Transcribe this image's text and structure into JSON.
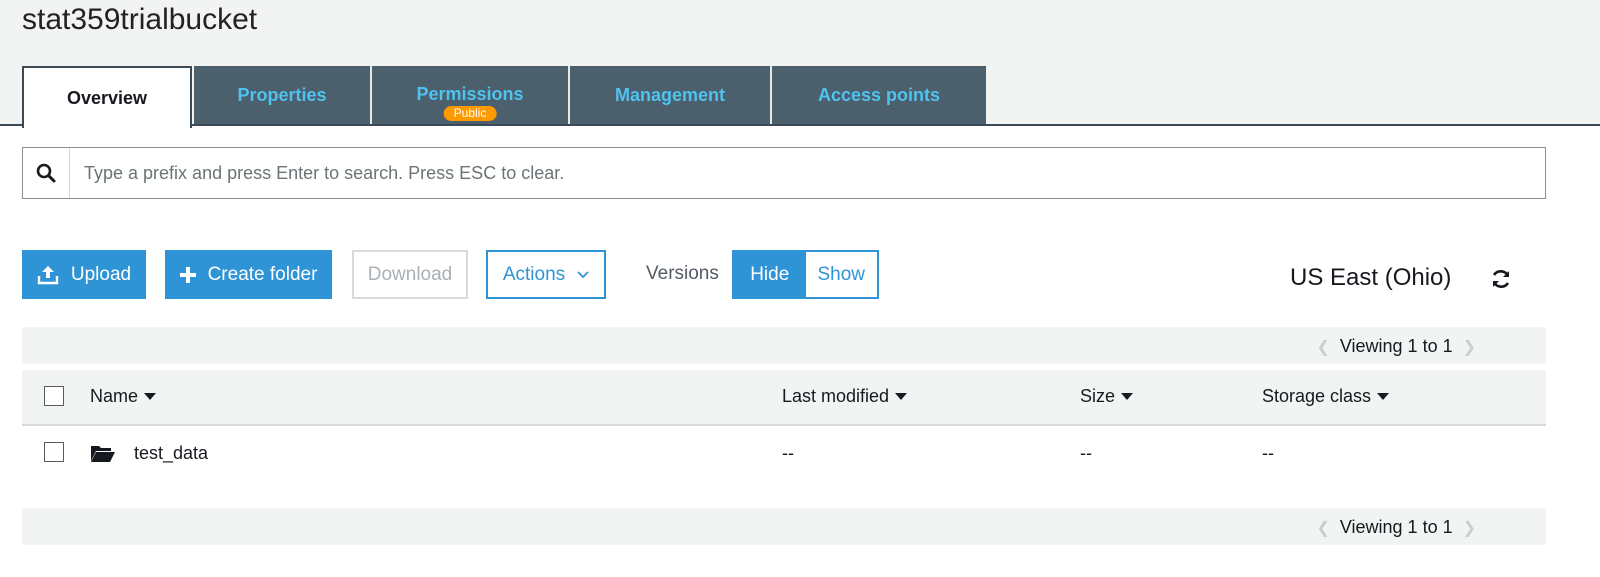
{
  "bucket": {
    "name": "stat359trialbucket"
  },
  "tabs": [
    {
      "label": "Overview"
    },
    {
      "label": "Properties"
    },
    {
      "label": "Permissions",
      "badge": "Public"
    },
    {
      "label": "Management"
    },
    {
      "label": "Access points"
    }
  ],
  "search": {
    "placeholder": "Type a prefix and press Enter to search. Press ESC to clear.",
    "value": "",
    "icon": "search-icon"
  },
  "toolbar": {
    "upload_label": "Upload",
    "create_folder_label": "Create folder",
    "download_label": "Download",
    "actions_label": "Actions",
    "versions_label": "Versions",
    "versions_hide": "Hide",
    "versions_show": "Show",
    "versions_selected": "Hide"
  },
  "region": "US East (Ohio)",
  "pager": {
    "top": "Viewing 1 to 1",
    "bottom": "Viewing 1 to 1"
  },
  "table": {
    "columns": [
      "Name",
      "Last modified",
      "Size",
      "Storage class"
    ],
    "rows": [
      {
        "name": "test_data",
        "type": "folder",
        "last_modified": "--",
        "size": "--",
        "storage_class": "--"
      }
    ]
  },
  "colors": {
    "accent": "#2f94d6",
    "tab_bg": "#4b5f6d",
    "tab_text": "#4fc3f0",
    "badge": "#ff9900"
  }
}
